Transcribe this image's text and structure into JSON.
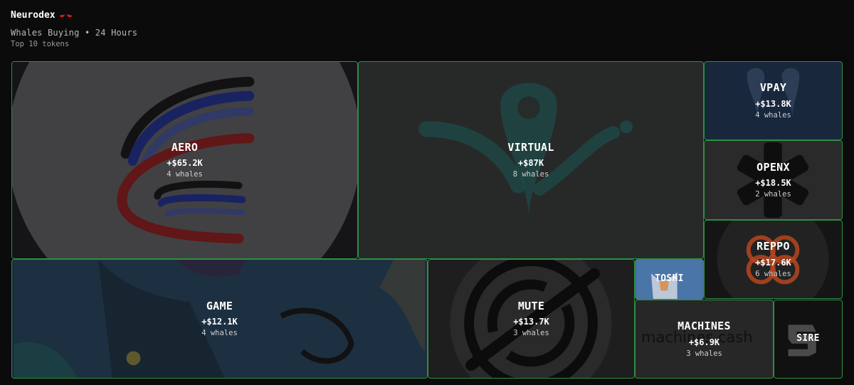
{
  "app": {
    "name": "Neurodex"
  },
  "view": {
    "subtitle": "Whales Buying • 24 Hours",
    "count_label": "Top 10 tokens"
  },
  "colors": {
    "tile_border": "#2e8f43",
    "background": "#0b0b0c",
    "brand_eyes": "#e01b1b"
  },
  "tokens": [
    {
      "symbol": "AERO",
      "amount": "+$65.2K",
      "whales": "4 whales",
      "icon": "aero-logo-icon"
    },
    {
      "symbol": "VIRTUAL",
      "amount": "+$87K",
      "whales": "8 whales",
      "icon": "virtual-logo-icon"
    },
    {
      "symbol": "VPAY",
      "amount": "+$13.8K",
      "whales": "4 whales",
      "icon": "vpay-logo-icon"
    },
    {
      "symbol": "OPENX",
      "amount": "+$18.5K",
      "whales": "2 whales",
      "icon": "openx-logo-icon"
    },
    {
      "symbol": "REPPO",
      "amount": "+$17.6K",
      "whales": "6 whales",
      "icon": "reppo-logo-icon"
    },
    {
      "symbol": "GAME",
      "amount": "+$12.1K",
      "whales": "4 whales",
      "icon": "game-art-icon"
    },
    {
      "symbol": "MUTE",
      "amount": "+$13.7K",
      "whales": "3 whales",
      "icon": "mute-logo-icon"
    },
    {
      "symbol": "TOSHI",
      "icon": "toshi-cat-icon"
    },
    {
      "symbol": "MACHINES",
      "amount": "+$6.9K",
      "whales": "3 whales",
      "icon": "machines-logo-icon",
      "logo_text": "machines cash"
    },
    {
      "symbol": "SIRE",
      "icon": "sire-logo-icon"
    }
  ]
}
